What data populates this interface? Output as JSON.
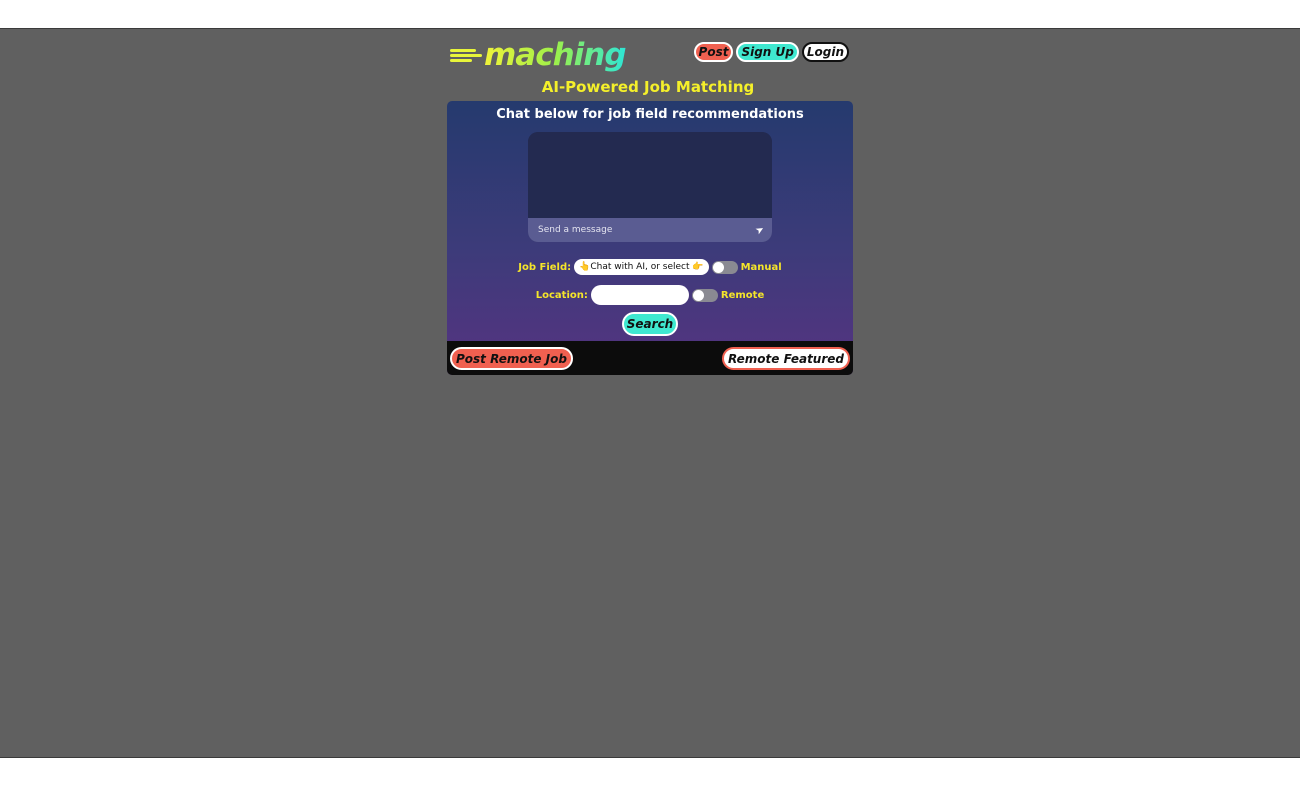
{
  "brand": {
    "logo_text": "maching",
    "tagline": "AI-Powered Job Matching"
  },
  "nav": {
    "post_label": "Post",
    "signup_label": "Sign Up",
    "login_label": "Login"
  },
  "chat": {
    "title": "Chat below for job field recommendations",
    "input_placeholder": "Send a message",
    "send_icon": "send-icon"
  },
  "filters": {
    "job_field_label": "Job Field:",
    "job_field_value": "👆Chat with AI, or select 👉",
    "manual_label": "Manual",
    "location_label": "Location:",
    "location_value": "",
    "remote_label": "Remote",
    "search_label": "Search"
  },
  "footer": {
    "post_remote_label": "Post Remote Job",
    "remote_featured_label": "Remote Featured"
  },
  "colors": {
    "accent_yellow": "#f5f02a",
    "accent_teal": "#3fe8d0",
    "accent_red": "#f06050",
    "background": "#606060"
  }
}
